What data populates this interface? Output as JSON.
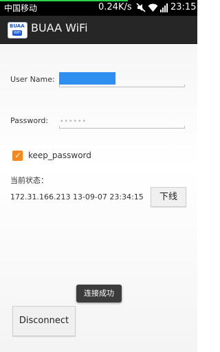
{
  "status_bar": {
    "carrier": "中国移动",
    "speed": "0.24K/s",
    "time": "23:15",
    "icons": [
      "mute-icon",
      "wifi-icon",
      "signal-icon",
      "battery-icon"
    ]
  },
  "action_bar": {
    "icon_text": "BUAA",
    "icon_sub": "WiFi",
    "title": "BUAA WiFi"
  },
  "form": {
    "username_label": "User Name:",
    "username_value": "",
    "password_label": "Password:",
    "password_value": "••••••",
    "keep_password_label": "keep_password",
    "keep_password_checked": true
  },
  "status": {
    "label": "当前状态：",
    "value": "172.31.166.213  13-09-07 23:34:15",
    "logout_button": "下线"
  },
  "toast": "连接成功",
  "disconnect_button": "Disconnect",
  "colors": {
    "accent_orange": "#f48a1f",
    "input_highlight": "#2f8ff0",
    "statusbar_progress": "#2bd34a"
  }
}
